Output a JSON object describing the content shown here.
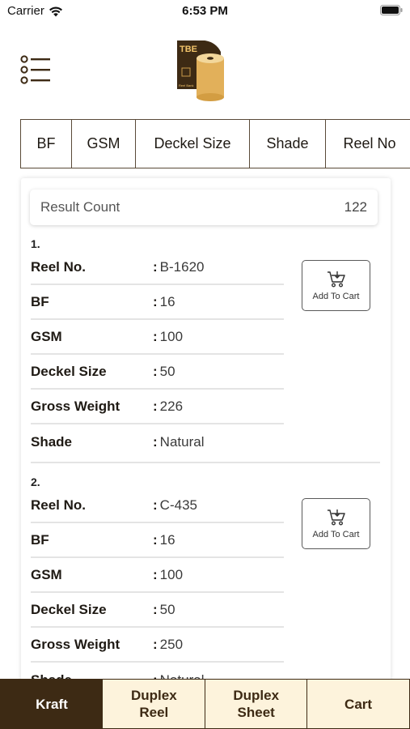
{
  "status_bar": {
    "carrier": "Carrier",
    "time": "6:53 PM"
  },
  "header": {
    "menu_icon": "list-menu-icon",
    "logo_text": "TBE",
    "logo_subtext": "Reel Bank"
  },
  "filters": [
    {
      "label": "BF"
    },
    {
      "label": "GSM"
    },
    {
      "label": "Deckel Size"
    },
    {
      "label": "Shade"
    },
    {
      "label": "Reel No"
    }
  ],
  "result_count": {
    "label": "Result Count",
    "value": "122"
  },
  "results": [
    {
      "index": "1.",
      "fields": [
        {
          "label": "Reel No.",
          "value": "B-1620"
        },
        {
          "label": "BF",
          "value": "16"
        },
        {
          "label": "GSM",
          "value": "100"
        },
        {
          "label": "Deckel Size",
          "value": "50"
        },
        {
          "label": "Gross Weight",
          "value": "226"
        },
        {
          "label": "Shade",
          "value": "Natural"
        }
      ],
      "button_label": "Add To Cart"
    },
    {
      "index": "2.",
      "fields": [
        {
          "label": "Reel No.",
          "value": "C-435"
        },
        {
          "label": "BF",
          "value": "16"
        },
        {
          "label": "GSM",
          "value": "100"
        },
        {
          "label": "Deckel Size",
          "value": "50"
        },
        {
          "label": "Gross Weight",
          "value": "250"
        },
        {
          "label": "Shade",
          "value": "Natural"
        }
      ],
      "button_label": "Add To Cart"
    }
  ],
  "colon": ":",
  "bottom_nav": [
    {
      "line1": "Kraft",
      "line2": "",
      "active": true
    },
    {
      "line1": "Duplex",
      "line2": "Reel",
      "active": false
    },
    {
      "line1": "Duplex",
      "line2": "Sheet",
      "active": false
    },
    {
      "line1": "Cart",
      "line2": "",
      "active": false
    }
  ],
  "colors": {
    "brand_dark": "#3d2a14",
    "nav_inactive_bg": "#fdf3dc",
    "logo_gold": "#e2b05a"
  }
}
